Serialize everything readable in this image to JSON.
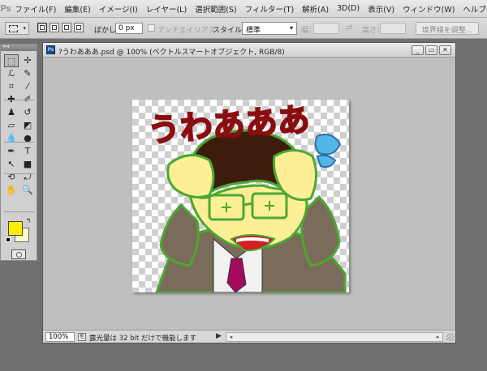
{
  "app": {
    "logo": "Ps"
  },
  "menu": [
    "ファイル(F)",
    "編集(E)",
    "イメージ(I)",
    "レイヤー(L)",
    "選択範囲(S)",
    "フィルター(T)",
    "解析(A)",
    "3D(D)",
    "表示(V)",
    "ウィンドウ(W)",
    "ヘルプ(H)"
  ],
  "options": {
    "feather_label": "ぼかし：",
    "feather_value": "0 px",
    "antialias_label": "アンチエイリアス",
    "style_label": "スタイル：",
    "style_value": "標準",
    "width_label": "幅：",
    "height_label": "高さ：",
    "refine_edge": "境界線を調整..."
  },
  "document": {
    "title": "?うわあああ.psd @ 100% (ベクトルスマートオブジェクト, RGB/8)",
    "icon_label": "Ps",
    "min_btn": "_",
    "restore_btn": "▭",
    "close_btn": "✕"
  },
  "artwork": {
    "shout_text": "うわあああ",
    "colors": {
      "hair": "#3d1c0d",
      "skin": "#fcef96",
      "suit": "#7b6b5a",
      "tie": "#a50a5c",
      "text_red": "#d21f24",
      "outline": "#4ca832",
      "sweat": "#52b7e6"
    }
  },
  "status": {
    "zoom": "100%",
    "text": "露光量は 32 bit だけで機能します",
    "arrow": "▶"
  },
  "colors": {
    "foreground": "#ffee00",
    "background": "#fdfbcb"
  },
  "tools_panel": {
    "grip": "◂◂",
    "swap": "↰",
    "icons": [
      {
        "name": "marquee-tool-icon",
        "glyph": "⬚"
      },
      {
        "name": "move-tool-icon",
        "glyph": "✢"
      },
      {
        "name": "lasso-tool-icon",
        "glyph": "ℒ"
      },
      {
        "name": "quick-select-tool-icon",
        "glyph": "✎"
      },
      {
        "name": "crop-tool-icon",
        "glyph": "⌗"
      },
      {
        "name": "eyedropper-tool-icon",
        "glyph": "⁄"
      },
      {
        "name": "healing-brush-icon",
        "glyph": "✚"
      },
      {
        "name": "brush-tool-icon",
        "glyph": "✐"
      },
      {
        "name": "clone-stamp-icon",
        "glyph": "♟"
      },
      {
        "name": "history-brush-icon",
        "glyph": "↺"
      },
      {
        "name": "eraser-tool-icon",
        "glyph": "▱"
      },
      {
        "name": "gradient-tool-icon",
        "glyph": "◩"
      },
      {
        "name": "blur-tool-icon",
        "glyph": "💧"
      },
      {
        "name": "dodge-tool-icon",
        "glyph": "●"
      },
      {
        "name": "pen-tool-icon",
        "glyph": "✒"
      },
      {
        "name": "type-tool-icon",
        "glyph": "T"
      },
      {
        "name": "path-select-tool-icon",
        "glyph": "↖"
      },
      {
        "name": "rectangle-tool-icon",
        "glyph": "■"
      },
      {
        "name": "3d-rotate-tool-icon",
        "glyph": "⟲"
      },
      {
        "name": "3d-orbit-tool-icon",
        "glyph": "⤾"
      },
      {
        "name": "hand-tool-icon",
        "glyph": "✋"
      },
      {
        "name": "zoom-tool-icon",
        "glyph": "🔍"
      }
    ]
  }
}
